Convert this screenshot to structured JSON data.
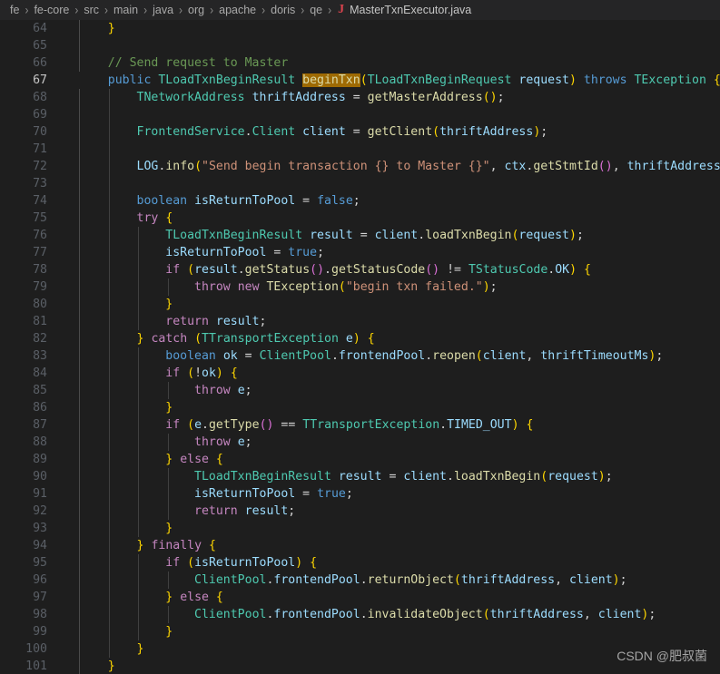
{
  "breadcrumb": {
    "separator": "›",
    "items": [
      "fe",
      "fe-core",
      "src",
      "main",
      "java",
      "org",
      "apache",
      "doris",
      "qe"
    ],
    "file_icon_label": "J",
    "file": "MasterTxnExecutor.java"
  },
  "editor": {
    "first_line_number": 64,
    "active_line_number": 67,
    "highlighted_token": "beginTxn",
    "lines": [
      {
        "n": 64,
        "text": "    }"
      },
      {
        "n": 65,
        "text": ""
      },
      {
        "n": 66,
        "text": "    // Send request to Master"
      },
      {
        "n": 67,
        "text": "    public TLoadTxnBeginResult beginTxn(TLoadTxnBeginRequest request) throws TException {"
      },
      {
        "n": 68,
        "text": "        TNetworkAddress thriftAddress = getMasterAddress();"
      },
      {
        "n": 69,
        "text": ""
      },
      {
        "n": 70,
        "text": "        FrontendService.Client client = getClient(thriftAddress);"
      },
      {
        "n": 71,
        "text": ""
      },
      {
        "n": 72,
        "text": "        LOG.info(\"Send begin transaction {} to Master {}\", ctx.getStmtId(), thriftAddress);"
      },
      {
        "n": 73,
        "text": ""
      },
      {
        "n": 74,
        "text": "        boolean isReturnToPool = false;"
      },
      {
        "n": 75,
        "text": "        try {"
      },
      {
        "n": 76,
        "text": "            TLoadTxnBeginResult result = client.loadTxnBegin(request);"
      },
      {
        "n": 77,
        "text": "            isReturnToPool = true;"
      },
      {
        "n": 78,
        "text": "            if (result.getStatus().getStatusCode() != TStatusCode.OK) {"
      },
      {
        "n": 79,
        "text": "                throw new TException(\"begin txn failed.\");"
      },
      {
        "n": 80,
        "text": "            }"
      },
      {
        "n": 81,
        "text": "            return result;"
      },
      {
        "n": 82,
        "text": "        } catch (TTransportException e) {"
      },
      {
        "n": 83,
        "text": "            boolean ok = ClientPool.frontendPool.reopen(client, thriftTimeoutMs);"
      },
      {
        "n": 84,
        "text": "            if (!ok) {"
      },
      {
        "n": 85,
        "text": "                throw e;"
      },
      {
        "n": 86,
        "text": "            }"
      },
      {
        "n": 87,
        "text": "            if (e.getType() == TTransportException.TIMED_OUT) {"
      },
      {
        "n": 88,
        "text": "                throw e;"
      },
      {
        "n": 89,
        "text": "            } else {"
      },
      {
        "n": 90,
        "text": "                TLoadTxnBeginResult result = client.loadTxnBegin(request);"
      },
      {
        "n": 91,
        "text": "                isReturnToPool = true;"
      },
      {
        "n": 92,
        "text": "                return result;"
      },
      {
        "n": 93,
        "text": "            }"
      },
      {
        "n": 94,
        "text": "        } finally {"
      },
      {
        "n": 95,
        "text": "            if (isReturnToPool) {"
      },
      {
        "n": 96,
        "text": "                ClientPool.frontendPool.returnObject(thriftAddress, client);"
      },
      {
        "n": 97,
        "text": "            } else {"
      },
      {
        "n": 98,
        "text": "                ClientPool.frontendPool.invalidateObject(thriftAddress, client);"
      },
      {
        "n": 99,
        "text": "            }"
      },
      {
        "n": 100,
        "text": "        }"
      },
      {
        "n": 101,
        "text": "    }"
      }
    ]
  },
  "watermark": "CSDN @肥叔菌",
  "colors": {
    "background": "#1e1e1e",
    "breadcrumb_background": "#252526",
    "gutter_text": "#5a5f66",
    "active_gutter_text": "#c6c6c6",
    "highlight_background": "#9e6a03",
    "keyword": "#569cd6",
    "control": "#c586c0",
    "type": "#4ec9b0",
    "function": "#dcdcaa",
    "variable": "#9cdcfe",
    "string": "#ce9178",
    "comment": "#6a9955",
    "bracket_0": "#ffd700",
    "bracket_1": "#da70d6",
    "bracket_2": "#179fff",
    "java_icon": "#d9434e"
  }
}
